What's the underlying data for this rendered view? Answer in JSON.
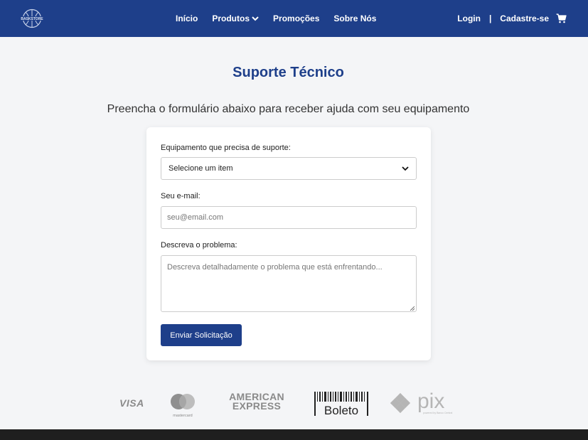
{
  "navbar": {
    "bg_color": "#1e3f8a",
    "logo_text": "BASKSTORE",
    "links": [
      "Início",
      "Produtos",
      "Promoções",
      "Sobre Nós"
    ],
    "login": "Login",
    "separator": "|",
    "signup": "Cadastre-se"
  },
  "page": {
    "title": "Suporte Técnico",
    "subtitle": "Preencha o formulário abaixo para receber ajuda com seu equipamento"
  },
  "form": {
    "equipment_label": "Equipamento que precisa de suporte:",
    "equipment_selected": "Selecione um item",
    "email_label": "Seu e-mail:",
    "email_placeholder": "seu@email.com",
    "problem_label": "Descreva o problema:",
    "problem_placeholder": "Descreva detalhadamente o problema que está enfrentando...",
    "submit_label": "Enviar Solicitação"
  },
  "payments": {
    "visa": "VISA",
    "mastercard": "mastercard",
    "amex_line1": "AMERICAN",
    "amex_line2": "EXPRESS",
    "boleto": "Boleto",
    "pix": "pix",
    "pix_caption": "powered by Banco Central"
  }
}
